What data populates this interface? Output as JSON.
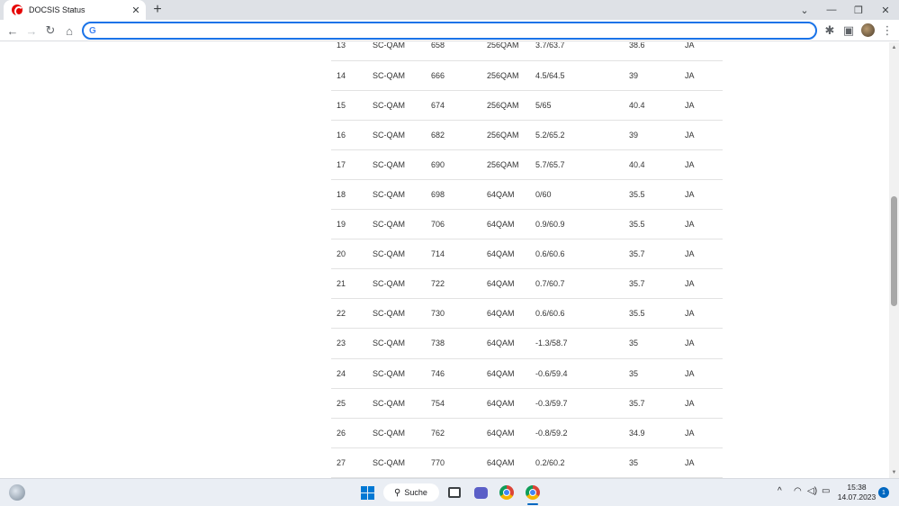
{
  "tab": {
    "title": "DOCSIS Status",
    "close": "✕",
    "new_tab": "+"
  },
  "window": {
    "minimize": "⌄",
    "restore": "—",
    "maximize": "❐",
    "close": "✕"
  },
  "toolbar": {
    "back": "←",
    "forward": "→",
    "reload": "↻",
    "home": "⌂",
    "omnibox_value": "",
    "google_glyph": "G",
    "extensions": "✱",
    "sidepanel": "▣",
    "menu": "⋮"
  },
  "channels": [
    {
      "id": "13",
      "type": "SC-QAM",
      "freq": "658",
      "mod": "256QAM",
      "power": "3.7/63.7",
      "mse": "38.6",
      "lock": "JA"
    },
    {
      "id": "14",
      "type": "SC-QAM",
      "freq": "666",
      "mod": "256QAM",
      "power": "4.5/64.5",
      "mse": "39",
      "lock": "JA"
    },
    {
      "id": "15",
      "type": "SC-QAM",
      "freq": "674",
      "mod": "256QAM",
      "power": "5/65",
      "mse": "40.4",
      "lock": "JA"
    },
    {
      "id": "16",
      "type": "SC-QAM",
      "freq": "682",
      "mod": "256QAM",
      "power": "5.2/65.2",
      "mse": "39",
      "lock": "JA"
    },
    {
      "id": "17",
      "type": "SC-QAM",
      "freq": "690",
      "mod": "256QAM",
      "power": "5.7/65.7",
      "mse": "40.4",
      "lock": "JA"
    },
    {
      "id": "18",
      "type": "SC-QAM",
      "freq": "698",
      "mod": "64QAM",
      "power": "0/60",
      "mse": "35.5",
      "lock": "JA"
    },
    {
      "id": "19",
      "type": "SC-QAM",
      "freq": "706",
      "mod": "64QAM",
      "power": "0.9/60.9",
      "mse": "35.5",
      "lock": "JA"
    },
    {
      "id": "20",
      "type": "SC-QAM",
      "freq": "714",
      "mod": "64QAM",
      "power": "0.6/60.6",
      "mse": "35.7",
      "lock": "JA"
    },
    {
      "id": "21",
      "type": "SC-QAM",
      "freq": "722",
      "mod": "64QAM",
      "power": "0.7/60.7",
      "mse": "35.7",
      "lock": "JA"
    },
    {
      "id": "22",
      "type": "SC-QAM",
      "freq": "730",
      "mod": "64QAM",
      "power": "0.6/60.6",
      "mse": "35.5",
      "lock": "JA"
    },
    {
      "id": "23",
      "type": "SC-QAM",
      "freq": "738",
      "mod": "64QAM",
      "power": "-1.3/58.7",
      "mse": "35",
      "lock": "JA"
    },
    {
      "id": "24",
      "type": "SC-QAM",
      "freq": "746",
      "mod": "64QAM",
      "power": "-0.6/59.4",
      "mse": "35",
      "lock": "JA"
    },
    {
      "id": "25",
      "type": "SC-QAM",
      "freq": "754",
      "mod": "64QAM",
      "power": "-0.3/59.7",
      "mse": "35.7",
      "lock": "JA"
    },
    {
      "id": "26",
      "type": "SC-QAM",
      "freq": "762",
      "mod": "64QAM",
      "power": "-0.8/59.2",
      "mse": "34.9",
      "lock": "JA"
    },
    {
      "id": "27",
      "type": "SC-QAM",
      "freq": "770",
      "mod": "64QAM",
      "power": "0.2/60.2",
      "mse": "35",
      "lock": "JA"
    }
  ],
  "taskbar": {
    "search_label": "Suche",
    "search_glyph": "⚲",
    "time": "15:38",
    "date": "14.07.2023",
    "notification_count": "1",
    "tray_chevron": "^",
    "wifi": "◠",
    "volume": "◁)",
    "battery": "▭"
  },
  "colors": {
    "accent": "#1a73e8",
    "vodafone": "#e60000",
    "windows_blue": "#0078d4"
  }
}
